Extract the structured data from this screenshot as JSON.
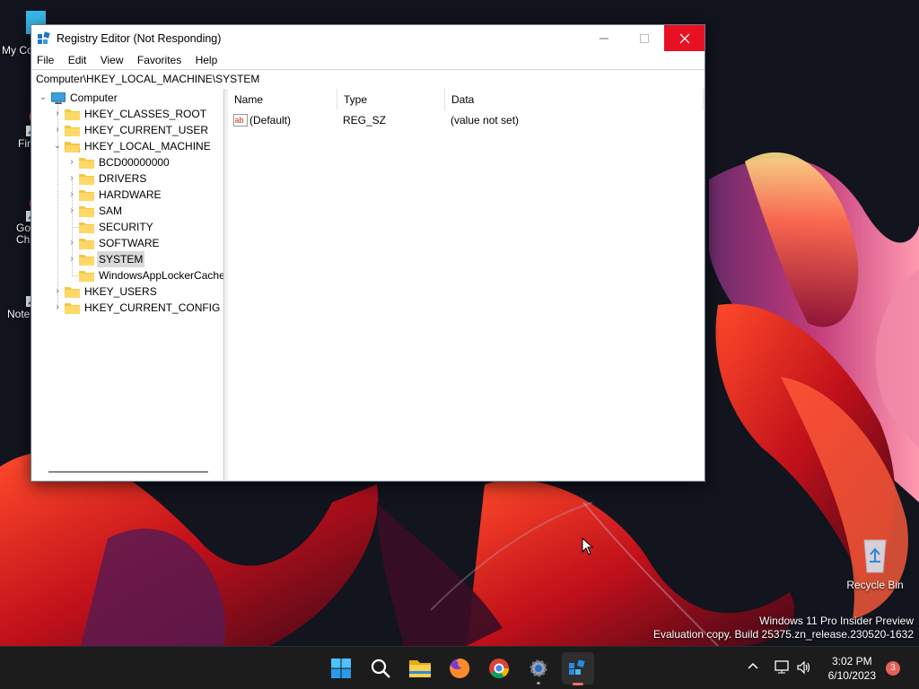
{
  "window": {
    "title": "Registry Editor (Not Responding)",
    "menu": [
      "File",
      "Edit",
      "View",
      "Favorites",
      "Help"
    ],
    "address": "Computer\\HKEY_LOCAL_MACHINE\\SYSTEM",
    "tree": {
      "root": "Computer",
      "hkcr": "HKEY_CLASSES_ROOT",
      "hkcu": "HKEY_CURRENT_USER",
      "hklm": "HKEY_LOCAL_MACHINE",
      "hklm_children": [
        "BCD00000000",
        "DRIVERS",
        "HARDWARE",
        "SAM",
        "SECURITY",
        "SOFTWARE",
        "SYSTEM",
        "WindowsAppLockerCache"
      ],
      "hku": "HKEY_USERS",
      "hkcc": "HKEY_CURRENT_CONFIG",
      "selected": "SYSTEM"
    },
    "columns": [
      "Name",
      "Type",
      "Data"
    ],
    "values": [
      {
        "name": "(Default)",
        "type": "REG_SZ",
        "data": "(value not set)",
        "icon": "string-value-icon"
      }
    ]
  },
  "desktop": {
    "icons": [
      "My Co",
      "Fir",
      "Go Chr",
      "Note"
    ],
    "recycle_bin": "Recycle Bin"
  },
  "watermark": {
    "line1": "Windows 11 Pro Insider Preview",
    "line2": "Evaluation copy. Build 25375.zn_release.230520-1632"
  },
  "taskbar": {
    "apps": [
      "start-icon",
      "search-icon",
      "file-explorer-icon",
      "firefox-icon",
      "chrome-icon",
      "settings-icon",
      "registry-editor-icon"
    ],
    "time": "3:02 PM",
    "date": "6/10/2023",
    "notification_count": "3"
  }
}
